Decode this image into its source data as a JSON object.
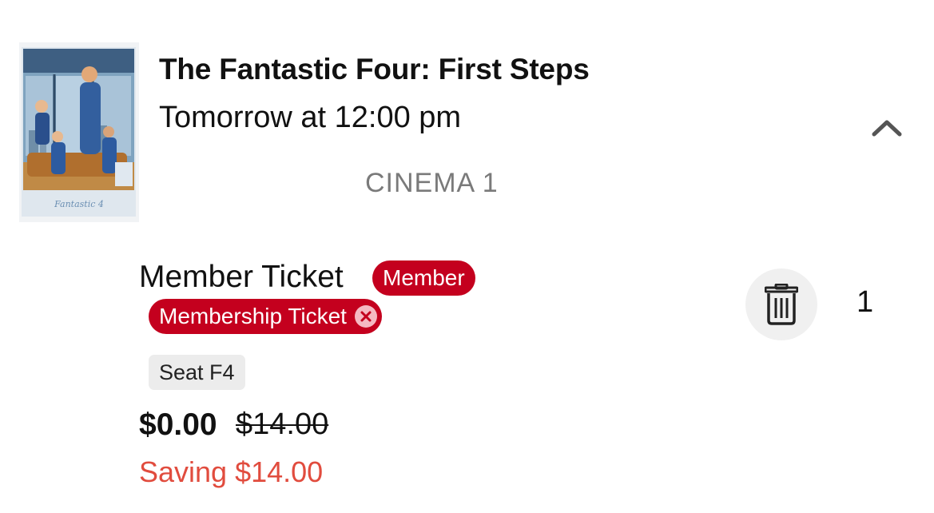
{
  "booking": {
    "movie_title": "The Fantastic Four: First Steps",
    "showtime": "Tomorrow at 12:00 pm",
    "screen": "CINEMA 1",
    "poster_logo": "Fantastic 4"
  },
  "ticket": {
    "type_label": "Member Ticket",
    "member_badge": "Member",
    "membership_badge": "Membership Ticket",
    "seat": "Seat F4",
    "price": "$0.00",
    "original_price": "$14.00",
    "saving": "Saving $14.00",
    "quantity": "1"
  },
  "icons": {
    "collapse": "chevron-up-icon",
    "remove_badge": "close-circle-icon",
    "delete": "trash-icon"
  },
  "colors": {
    "badge_red": "#c4001e",
    "saving_red": "#e14c3e",
    "muted_text": "#7a7a7a",
    "chip_bg": "#ececec"
  }
}
